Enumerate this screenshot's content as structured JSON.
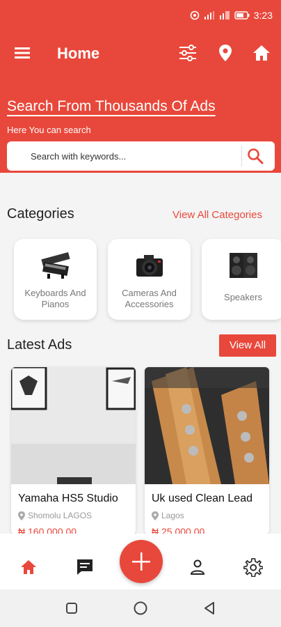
{
  "status": {
    "time": "3:23"
  },
  "appbar": {
    "title": "Home",
    "icons": [
      "menu-icon",
      "filter-icon",
      "location-icon",
      "home-icon"
    ]
  },
  "search": {
    "heading": "Search From Thousands Of Ads",
    "subheading": "Here You can search",
    "placeholder": "Search with keywords..."
  },
  "categories": {
    "title": "Categories",
    "view_all": "View All Categories",
    "items": [
      {
        "label": "Keyboards And Pianos",
        "icon": "keyboard-icon"
      },
      {
        "label": "Cameras And Accessories",
        "icon": "camera-icon"
      },
      {
        "label": "Speakers",
        "icon": "speaker-icon"
      }
    ]
  },
  "latest": {
    "title": "Latest Ads",
    "view_all": "View All",
    "ads": [
      {
        "name": "Yamaha HS5 Studio",
        "location": "Shomolu LAGOS",
        "price": "₦ 160,000.00"
      },
      {
        "name": "Uk used Clean Lead",
        "location": "Lagos",
        "price": "₦ 25,000.00"
      }
    ]
  },
  "bottom_nav": [
    "home-icon",
    "chat-icon",
    "add-icon",
    "profile-icon",
    "settings-icon"
  ],
  "colors": {
    "accent": "#e8483b"
  }
}
